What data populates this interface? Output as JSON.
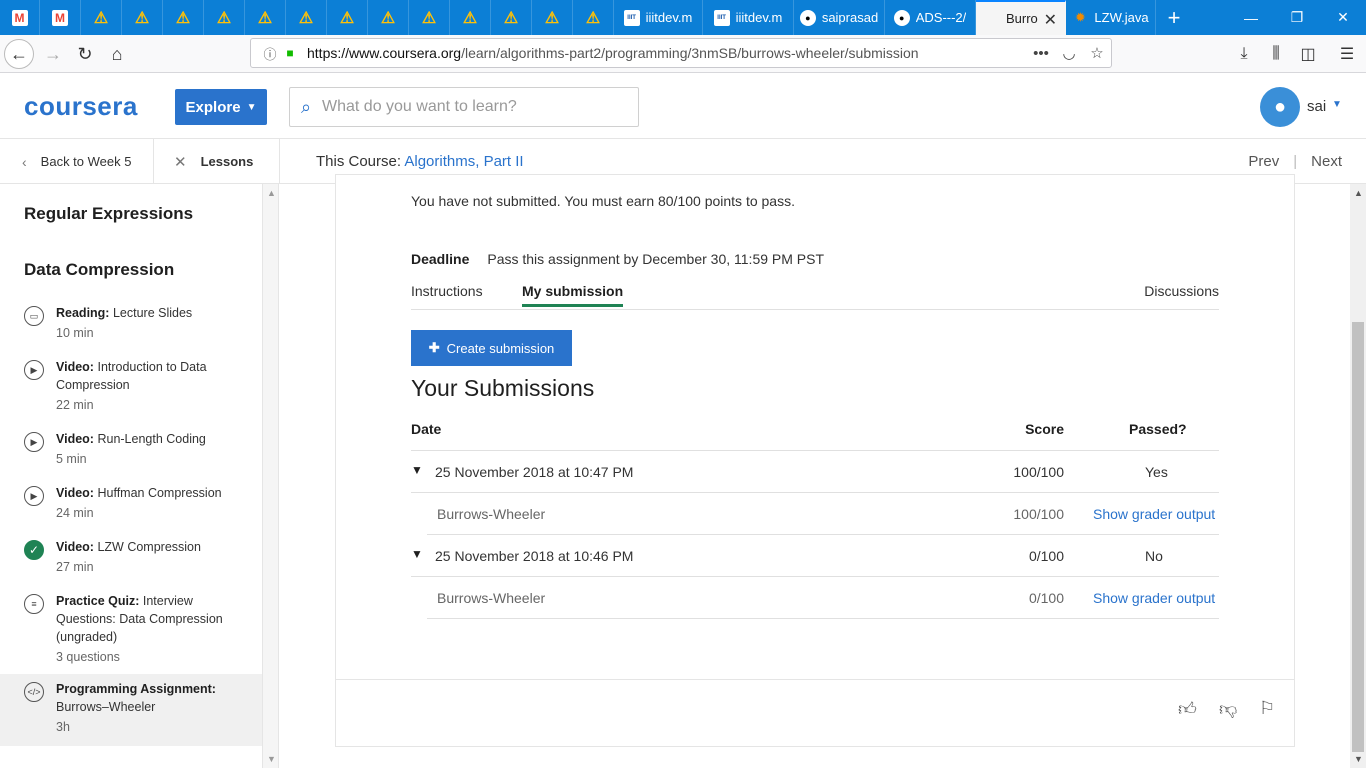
{
  "browser": {
    "tabs": [
      {
        "icon": "gmail-icon",
        "glyph": "M",
        "label": ""
      },
      {
        "icon": "gmail-icon",
        "glyph": "M",
        "label": ""
      },
      {
        "icon": "warning-icon",
        "glyph": "⚠",
        "label": ""
      },
      {
        "icon": "warning-icon",
        "glyph": "⚠",
        "label": ""
      },
      {
        "icon": "warning-icon",
        "glyph": "⚠",
        "label": ""
      },
      {
        "icon": "warning-icon",
        "glyph": "⚠",
        "label": ""
      },
      {
        "icon": "warning-icon",
        "glyph": "⚠",
        "label": ""
      },
      {
        "icon": "warning-icon",
        "glyph": "⚠",
        "label": ""
      },
      {
        "icon": "warning-icon",
        "glyph": "⚠",
        "label": ""
      },
      {
        "icon": "warning-icon",
        "glyph": "⚠",
        "label": ""
      },
      {
        "icon": "warning-icon",
        "glyph": "⚠",
        "label": ""
      },
      {
        "icon": "warning-icon",
        "glyph": "⚠",
        "label": ""
      },
      {
        "icon": "warning-icon",
        "glyph": "⚠",
        "label": ""
      },
      {
        "icon": "warning-icon",
        "glyph": "⚠",
        "label": ""
      },
      {
        "icon": "iiit-icon",
        "glyph": "IIIT",
        "label": "iiitdev.m"
      },
      {
        "icon": "iiit-icon",
        "glyph": "IIIT",
        "label": "iiitdev.m"
      },
      {
        "icon": "github-icon",
        "glyph": "●",
        "label": "saiprasad"
      },
      {
        "icon": "github-icon",
        "glyph": "●",
        "label": "ADS---2/"
      },
      {
        "icon": "coursera-icon",
        "glyph": "",
        "label": "Burro",
        "active": true
      },
      {
        "icon": "lzw-icon",
        "glyph": "✹",
        "label": "LZW.java"
      }
    ],
    "new_tab": "+",
    "window": {
      "minimize": "—",
      "maximize": "❐",
      "close": "✕"
    },
    "url_host": "https://www.coursera.org",
    "url_path": "/learn/algorithms-part2/programming/3nmSB/burrows-wheeler/submission"
  },
  "header": {
    "logo": "coursera",
    "explore_label": "Explore",
    "search_placeholder": "What do you want to learn?",
    "user_name": "sai"
  },
  "subnav": {
    "back_label": "Back to Week 5",
    "lessons_label": "Lessons",
    "this_course_prefix": "This Course: ",
    "course_name": "Algorithms, Part II",
    "prev_label": "Prev",
    "next_label": "Next"
  },
  "sidebar": {
    "section1": "Regular Expressions",
    "section2": "Data Compression",
    "items": [
      {
        "kind": "Reading:",
        "title": "Lecture Slides",
        "dur": "10 min",
        "icon": "book-icon"
      },
      {
        "kind": "Video:",
        "title": "Introduction to Data Compression",
        "dur": "22 min",
        "icon": "play-icon"
      },
      {
        "kind": "Video:",
        "title": "Run-Length Coding",
        "dur": "5 min",
        "icon": "play-icon"
      },
      {
        "kind": "Video:",
        "title": "Huffman Compression",
        "dur": "24 min",
        "icon": "play-icon"
      },
      {
        "kind": "Video:",
        "title": "LZW Compression",
        "dur": "27 min",
        "icon": "checkmark-icon"
      },
      {
        "kind": "Practice Quiz:",
        "title": "Interview Questions: Data Compression (ungraded)",
        "dur": "3 questions",
        "icon": "quiz-icon"
      },
      {
        "kind": "Programming Assignment:",
        "title": "Burrows–Wheeler",
        "dur": "3h",
        "icon": "code-icon"
      }
    ]
  },
  "main": {
    "notice": "You have not submitted. You must earn 80/100 points to pass.",
    "deadline_label": "Deadline",
    "deadline_value": "Pass this assignment by December 30, 11:59 PM PST",
    "tab_instructions": "Instructions",
    "tab_my_submission": "My submission",
    "tab_discussions": "Discussions",
    "create_label": "Create submission",
    "submissions_title": "Your Submissions",
    "col_date": "Date",
    "col_score": "Score",
    "col_passed": "Passed?",
    "submissions": [
      {
        "date": "25 November 2018 at 10:47 PM",
        "score": "100/100",
        "passed": "Yes",
        "part": "Burrows-Wheeler",
        "part_score": "100/100",
        "show_label": "Show grader output"
      },
      {
        "date": "25 November 2018 at 10:46 PM",
        "score": "0/100",
        "passed": "No",
        "part": "Burrows-Wheeler",
        "part_score": "0/100",
        "show_label": "Show grader output"
      }
    ]
  }
}
